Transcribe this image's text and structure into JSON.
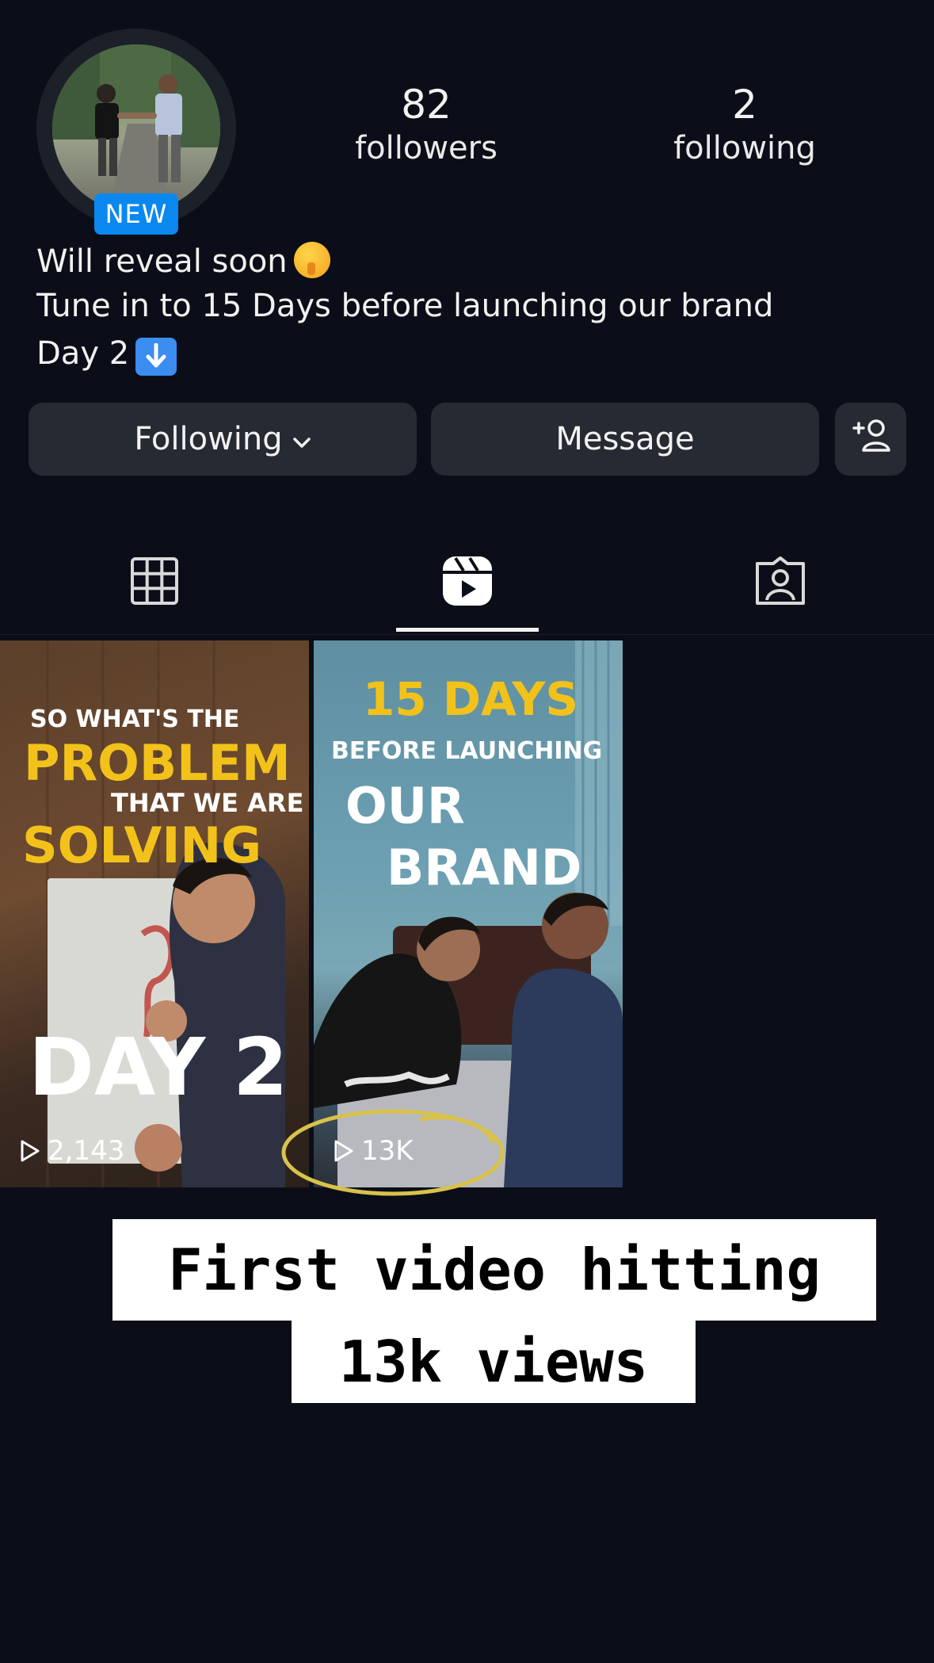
{
  "profile": {
    "badge": "NEW",
    "followers_count": "82",
    "followers_label": "followers",
    "following_count": "2",
    "following_label": "following",
    "bio": [
      "Will reveal soon",
      "Tune in to 15 Days before launching our brand",
      "Day 2"
    ]
  },
  "actions": {
    "following_label": "Following",
    "message_label": "Message"
  },
  "tabs": [
    {
      "icon": "grid-icon"
    },
    {
      "icon": "reels-icon",
      "active": true
    },
    {
      "icon": "tagged-icon"
    }
  ],
  "reels": [
    {
      "overlay_line1": "SO WHAT'S THE",
      "overlay_line2": "PROBLEM",
      "overlay_line3": "THAT WE ARE",
      "overlay_line4": "SOLVING",
      "overlay_day": "DAY 2",
      "views": "2,143"
    },
    {
      "overlay_line1": "15 DAYS",
      "overlay_line2": "BEFORE LAUNCHING",
      "overlay_line3": "OUR",
      "overlay_line4": "BRAND",
      "views": "13K"
    }
  ],
  "caption": {
    "line1": "First video hitting",
    "line2": "13k views"
  },
  "colors": {
    "background": "#0b0e18",
    "button": "#262a33",
    "badge": "#0a88f0",
    "overlay_yellow": "#f2c21b",
    "highlight_circle": "#d8c24a"
  }
}
